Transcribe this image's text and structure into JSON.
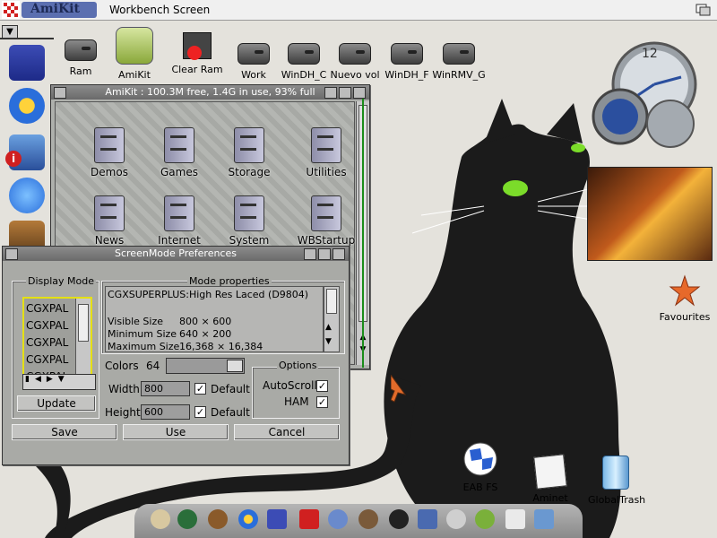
{
  "screen": {
    "logo_text": "AmiKit",
    "title": "Workbench Screen"
  },
  "desktop_icons": [
    {
      "label": "Ram"
    },
    {
      "label": "AmiKit"
    },
    {
      "label": "Clear Ram"
    },
    {
      "label": "Work"
    },
    {
      "label": "WinDH_C"
    },
    {
      "label": "Nuevo vol"
    },
    {
      "label": "WinDH_F"
    },
    {
      "label": "WinRMV_G"
    }
  ],
  "right_icons": {
    "favourites": "Favourites",
    "eab_fs": "EAB FS",
    "aminet": "Aminet",
    "trash": "GlobalTrash"
  },
  "clock": {
    "digit_top": "12"
  },
  "amikit_window": {
    "title": "AmiKit : 100.3M free, 1.4G in use, 93% full",
    "icons": [
      {
        "label": "Demos"
      },
      {
        "label": "Games"
      },
      {
        "label": "Storage"
      },
      {
        "label": "Utilities"
      },
      {
        "label": "News"
      },
      {
        "label": "Internet"
      },
      {
        "label": "System"
      },
      {
        "label": "WBStartup"
      }
    ]
  },
  "screenmode": {
    "title": "ScreenMode Preferences",
    "display_mode_label": "Display Mode",
    "modes": [
      "CGXPAL",
      "CGXPAL",
      "CGXPAL",
      "CGXPAL",
      "CGXPAL"
    ],
    "update_label": "Update",
    "mode_props_label": "Mode properties",
    "mode_name": "CGXSUPERPLUS:High Res Laced (D9804)",
    "visible_size_label": "Visible Size",
    "visible_size": "800 ×  600",
    "min_size_label": "Minimum Size",
    "min_size": "640 ×  200",
    "max_size_label": "Maximum Size",
    "max_size": "16,368 × 16,384",
    "colors_label": "Colors",
    "colors_value": "64",
    "options_label": "Options",
    "autoscroll_label": "AutoScroll",
    "ham_label": "HAM",
    "width_label": "Width",
    "width_value": "800",
    "height_label": "Height",
    "height_value": "600",
    "default_label": "Default",
    "save_label": "Save",
    "use_label": "Use",
    "cancel_label": "Cancel"
  },
  "colors": {
    "cat": "#1b1b1b",
    "cat_eye": "#7bdc2a",
    "listbox_border": "#e5e014",
    "window_gray": "#a9aaa6"
  }
}
